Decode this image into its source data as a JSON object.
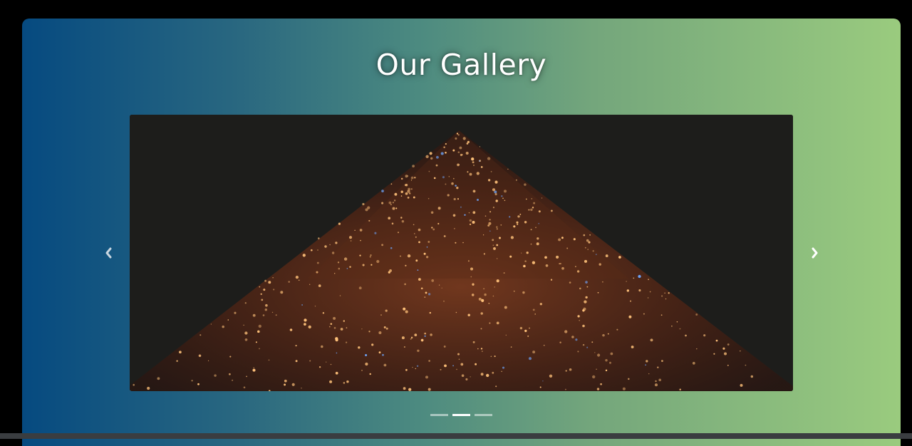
{
  "gallery": {
    "title": "Our Gallery",
    "slide": {
      "image": "christmas-tree-lights-photo"
    },
    "controls": {
      "prev_icon": "chevron-left-icon",
      "next_icon": "chevron-right-icon"
    },
    "indicators": {
      "count": 3,
      "active_index": 1
    }
  },
  "colors": {
    "page_background": "#000000",
    "gradient_start": "#064a80",
    "gradient_end": "#9acb7e",
    "title_color": "#ffffff",
    "photo_background": "#1d1d1b",
    "light_warm": "#ffc27a",
    "light_cool": "#6fa8ff",
    "bottom_bar": "#3a3d40"
  }
}
